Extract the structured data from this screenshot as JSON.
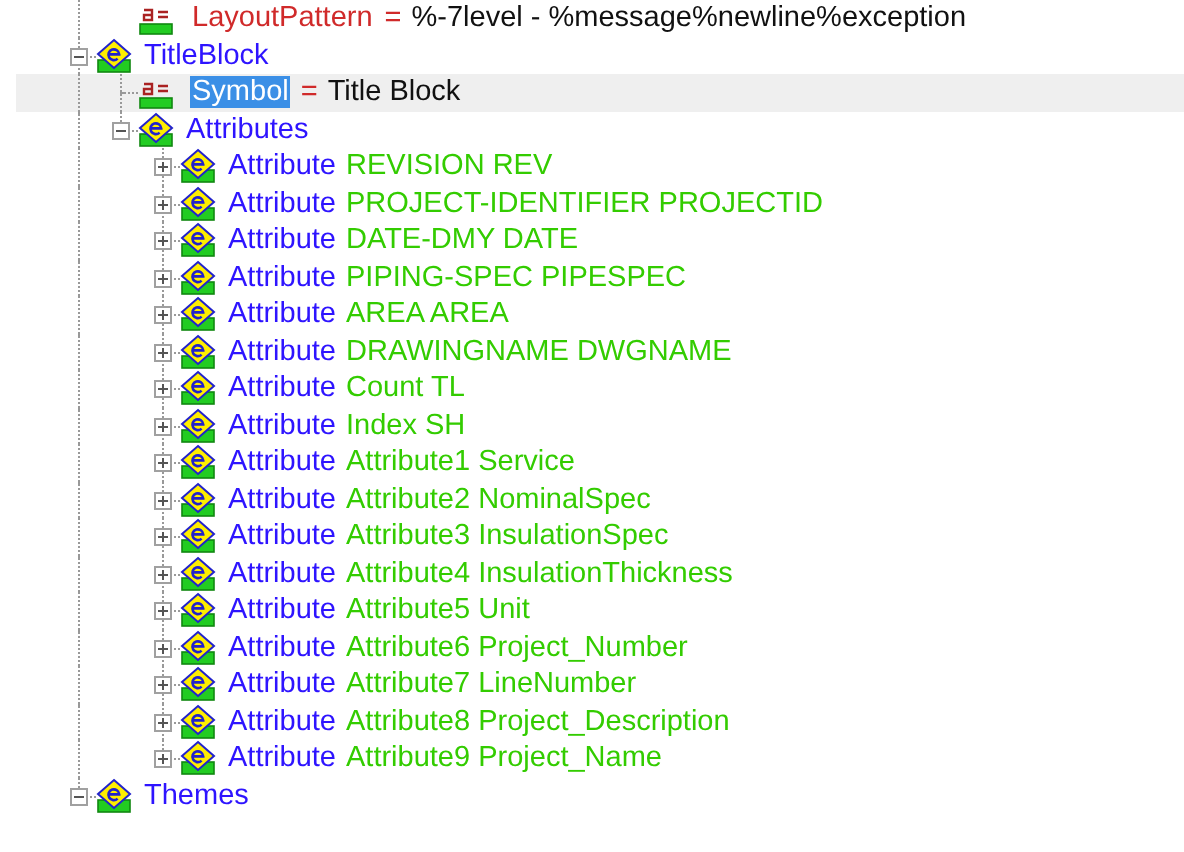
{
  "partial_row": {
    "kind": "property",
    "name": "LayoutPattern",
    "operator": "=",
    "value": "%-7level - %message%newline%exception",
    "selected": false
  },
  "tree": [
    {
      "kind": "element",
      "name": "TitleBlock",
      "expanded": true,
      "children": [
        {
          "kind": "property",
          "name": "Symbol",
          "operator": "=",
          "value": "Title Block",
          "selected": true
        },
        {
          "kind": "element",
          "name": "Attributes",
          "expanded": true,
          "children": [
            {
              "kind": "element",
              "name": "Attribute",
              "value": "REVISION REV",
              "expanded": false
            },
            {
              "kind": "element",
              "name": "Attribute",
              "value": "PROJECT-IDENTIFIER PROJECTID",
              "expanded": false
            },
            {
              "kind": "element",
              "name": "Attribute",
              "value": "DATE-DMY DATE",
              "expanded": false
            },
            {
              "kind": "element",
              "name": "Attribute",
              "value": "PIPING-SPEC PIPESPEC",
              "expanded": false
            },
            {
              "kind": "element",
              "name": "Attribute",
              "value": "AREA AREA",
              "expanded": false
            },
            {
              "kind": "element",
              "name": "Attribute",
              "value": "DRAWINGNAME DWGNAME",
              "expanded": false
            },
            {
              "kind": "element",
              "name": "Attribute",
              "value": "Count TL",
              "expanded": false
            },
            {
              "kind": "element",
              "name": "Attribute",
              "value": "Index SH",
              "expanded": false
            },
            {
              "kind": "element",
              "name": "Attribute",
              "value": "Attribute1 Service",
              "expanded": false
            },
            {
              "kind": "element",
              "name": "Attribute",
              "value": "Attribute2 NominalSpec",
              "expanded": false
            },
            {
              "kind": "element",
              "name": "Attribute",
              "value": "Attribute3 InsulationSpec",
              "expanded": false
            },
            {
              "kind": "element",
              "name": "Attribute",
              "value": "Attribute4 InsulationThickness",
              "expanded": false
            },
            {
              "kind": "element",
              "name": "Attribute",
              "value": "Attribute5 Unit",
              "expanded": false
            },
            {
              "kind": "element",
              "name": "Attribute",
              "value": "Attribute6 Project_Number",
              "expanded": false
            },
            {
              "kind": "element",
              "name": "Attribute",
              "value": "Attribute7 LineNumber",
              "expanded": false
            },
            {
              "kind": "element",
              "name": "Attribute",
              "value": "Attribute8 Project_Description",
              "expanded": false
            },
            {
              "kind": "element",
              "name": "Attribute",
              "value": "Attribute9 Project_Name",
              "expanded": false
            }
          ]
        }
      ]
    },
    {
      "kind": "element",
      "name": "Themes",
      "expanded": true
    }
  ]
}
